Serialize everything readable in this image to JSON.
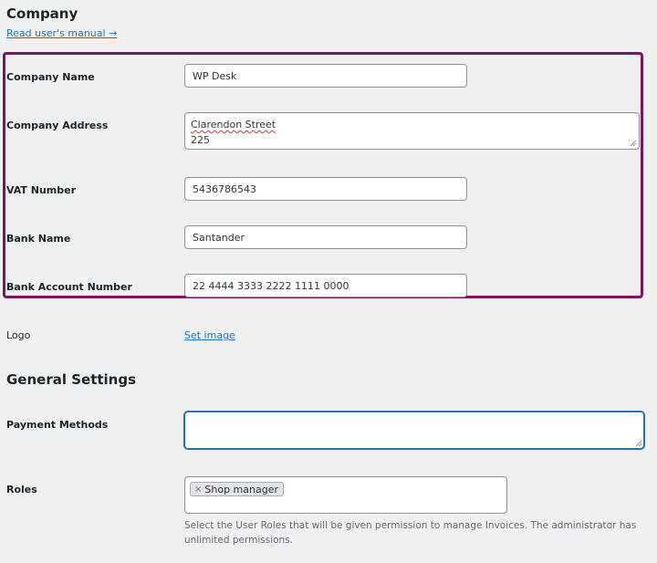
{
  "company": {
    "title": "Company",
    "manual_link": "Read user's manual →",
    "fields": {
      "company_name": {
        "label": "Company Name",
        "value": "WP Desk"
      },
      "company_address": {
        "label": "Company Address",
        "line1": "Clarendon Street",
        "line2": "225"
      },
      "vat_number": {
        "label": "VAT Number",
        "value": "5436786543"
      },
      "bank_name": {
        "label": "Bank Name",
        "value": "Santander"
      },
      "bank_account": {
        "label": "Bank Account Number",
        "value": "22 4444 3333 2222 1111 0000"
      }
    },
    "logo": {
      "label": "Logo",
      "link": "Set image"
    }
  },
  "general": {
    "title": "General Settings",
    "payment_methods": {
      "label": "Payment Methods",
      "value": ""
    },
    "roles": {
      "label": "Roles",
      "tokens": [
        {
          "remove_symbol": "×",
          "label": "Shop manager"
        }
      ],
      "description": "Select the User Roles that will be given permission to manage Invoices. The administrator has unlimited permissions."
    }
  },
  "colors": {
    "highlight": "#7a1660",
    "link": "#2271b1",
    "focus": "#2271b1",
    "page_bg": "#f0f0f1"
  }
}
